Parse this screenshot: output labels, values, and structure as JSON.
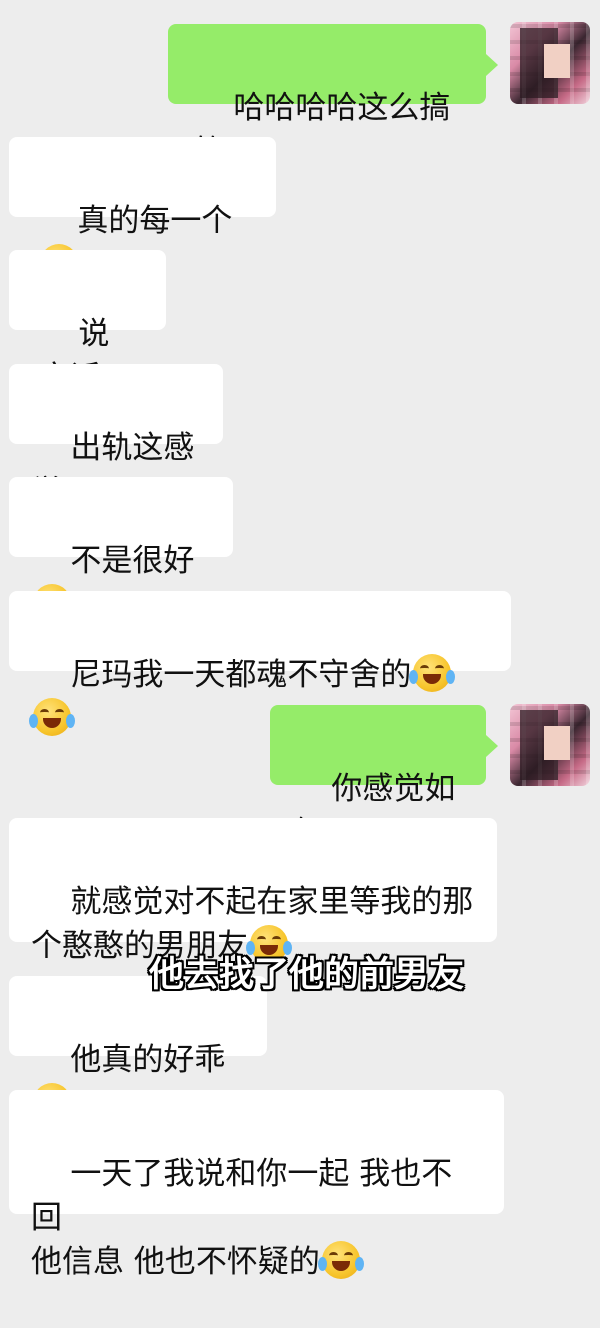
{
  "messages": [
    {
      "side": "out",
      "text": "哈哈哈哈这么搞笑",
      "emoji": 0
    },
    {
      "side": "in",
      "text": "真的每一个",
      "emoji": 1
    },
    {
      "side": "in",
      "text": "说实话",
      "emoji": 0
    },
    {
      "side": "in",
      "text": "出轨这感觉",
      "emoji": 0
    },
    {
      "side": "in",
      "text": "不是很好",
      "emoji": 1
    },
    {
      "side": "in",
      "text": "尼玛我一天都魂不守舍的",
      "emoji": 2
    },
    {
      "side": "out",
      "text": "你感觉如何",
      "emoji": 0
    },
    {
      "side": "in",
      "text": "就感觉对不起在家里等我的那\n个憨憨的男朋友",
      "emoji": 1
    },
    {
      "side": "in",
      "text": "他真的好乖",
      "emoji": 1
    },
    {
      "side": "in",
      "text": "一天了我说和你一起 我也不回\n他信息 他也不怀疑的",
      "emoji": 1
    }
  ],
  "emoji_names": {
    "face-with-tears-of-joy": "face-with-tears-of-joy-icon",
    "crying": "loudly-crying-face-icon"
  },
  "subtitle": "他去找了他的前男友",
  "colors": {
    "background": "#ededed",
    "outgoing_bubble": "#95ec69",
    "incoming_bubble": "#ffffff"
  }
}
